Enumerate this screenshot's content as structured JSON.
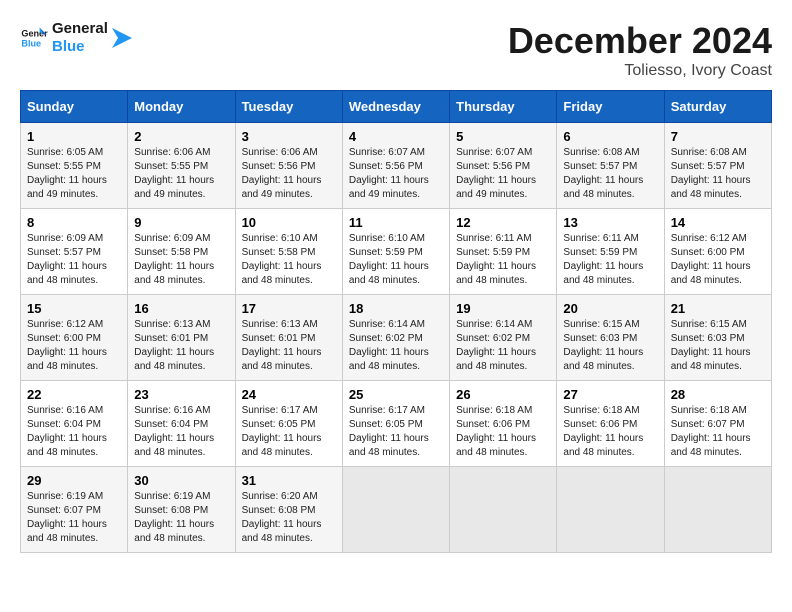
{
  "logo": {
    "line1": "General",
    "line2": "Blue"
  },
  "title": "December 2024",
  "location": "Toliesso, Ivory Coast",
  "days_header": [
    "Sunday",
    "Monday",
    "Tuesday",
    "Wednesday",
    "Thursday",
    "Friday",
    "Saturday"
  ],
  "weeks": [
    [
      {
        "day": "1",
        "sunrise": "6:05 AM",
        "sunset": "5:55 PM",
        "daylight": "11 hours and 49 minutes."
      },
      {
        "day": "2",
        "sunrise": "6:06 AM",
        "sunset": "5:55 PM",
        "daylight": "11 hours and 49 minutes."
      },
      {
        "day": "3",
        "sunrise": "6:06 AM",
        "sunset": "5:56 PM",
        "daylight": "11 hours and 49 minutes."
      },
      {
        "day": "4",
        "sunrise": "6:07 AM",
        "sunset": "5:56 PM",
        "daylight": "11 hours and 49 minutes."
      },
      {
        "day": "5",
        "sunrise": "6:07 AM",
        "sunset": "5:56 PM",
        "daylight": "11 hours and 49 minutes."
      },
      {
        "day": "6",
        "sunrise": "6:08 AM",
        "sunset": "5:57 PM",
        "daylight": "11 hours and 48 minutes."
      },
      {
        "day": "7",
        "sunrise": "6:08 AM",
        "sunset": "5:57 PM",
        "daylight": "11 hours and 48 minutes."
      }
    ],
    [
      {
        "day": "8",
        "sunrise": "6:09 AM",
        "sunset": "5:57 PM",
        "daylight": "11 hours and 48 minutes."
      },
      {
        "day": "9",
        "sunrise": "6:09 AM",
        "sunset": "5:58 PM",
        "daylight": "11 hours and 48 minutes."
      },
      {
        "day": "10",
        "sunrise": "6:10 AM",
        "sunset": "5:58 PM",
        "daylight": "11 hours and 48 minutes."
      },
      {
        "day": "11",
        "sunrise": "6:10 AM",
        "sunset": "5:59 PM",
        "daylight": "11 hours and 48 minutes."
      },
      {
        "day": "12",
        "sunrise": "6:11 AM",
        "sunset": "5:59 PM",
        "daylight": "11 hours and 48 minutes."
      },
      {
        "day": "13",
        "sunrise": "6:11 AM",
        "sunset": "5:59 PM",
        "daylight": "11 hours and 48 minutes."
      },
      {
        "day": "14",
        "sunrise": "6:12 AM",
        "sunset": "6:00 PM",
        "daylight": "11 hours and 48 minutes."
      }
    ],
    [
      {
        "day": "15",
        "sunrise": "6:12 AM",
        "sunset": "6:00 PM",
        "daylight": "11 hours and 48 minutes."
      },
      {
        "day": "16",
        "sunrise": "6:13 AM",
        "sunset": "6:01 PM",
        "daylight": "11 hours and 48 minutes."
      },
      {
        "day": "17",
        "sunrise": "6:13 AM",
        "sunset": "6:01 PM",
        "daylight": "11 hours and 48 minutes."
      },
      {
        "day": "18",
        "sunrise": "6:14 AM",
        "sunset": "6:02 PM",
        "daylight": "11 hours and 48 minutes."
      },
      {
        "day": "19",
        "sunrise": "6:14 AM",
        "sunset": "6:02 PM",
        "daylight": "11 hours and 48 minutes."
      },
      {
        "day": "20",
        "sunrise": "6:15 AM",
        "sunset": "6:03 PM",
        "daylight": "11 hours and 48 minutes."
      },
      {
        "day": "21",
        "sunrise": "6:15 AM",
        "sunset": "6:03 PM",
        "daylight": "11 hours and 48 minutes."
      }
    ],
    [
      {
        "day": "22",
        "sunrise": "6:16 AM",
        "sunset": "6:04 PM",
        "daylight": "11 hours and 48 minutes."
      },
      {
        "day": "23",
        "sunrise": "6:16 AM",
        "sunset": "6:04 PM",
        "daylight": "11 hours and 48 minutes."
      },
      {
        "day": "24",
        "sunrise": "6:17 AM",
        "sunset": "6:05 PM",
        "daylight": "11 hours and 48 minutes."
      },
      {
        "day": "25",
        "sunrise": "6:17 AM",
        "sunset": "6:05 PM",
        "daylight": "11 hours and 48 minutes."
      },
      {
        "day": "26",
        "sunrise": "6:18 AM",
        "sunset": "6:06 PM",
        "daylight": "11 hours and 48 minutes."
      },
      {
        "day": "27",
        "sunrise": "6:18 AM",
        "sunset": "6:06 PM",
        "daylight": "11 hours and 48 minutes."
      },
      {
        "day": "28",
        "sunrise": "6:18 AM",
        "sunset": "6:07 PM",
        "daylight": "11 hours and 48 minutes."
      }
    ],
    [
      {
        "day": "29",
        "sunrise": "6:19 AM",
        "sunset": "6:07 PM",
        "daylight": "11 hours and 48 minutes."
      },
      {
        "day": "30",
        "sunrise": "6:19 AM",
        "sunset": "6:08 PM",
        "daylight": "11 hours and 48 minutes."
      },
      {
        "day": "31",
        "sunrise": "6:20 AM",
        "sunset": "6:08 PM",
        "daylight": "11 hours and 48 minutes."
      },
      null,
      null,
      null,
      null
    ]
  ]
}
